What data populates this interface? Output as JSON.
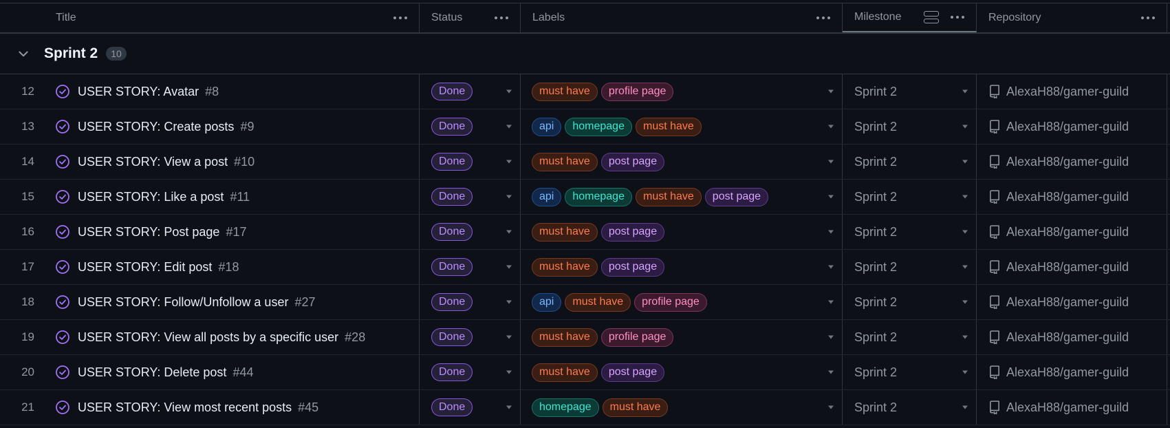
{
  "columns": {
    "title": "Title",
    "status": "Status",
    "labels": "Labels",
    "milestone": "Milestone",
    "repository": "Repository"
  },
  "group": {
    "title": "Sprint 2",
    "count": "10"
  },
  "label_styles": {
    "must have": {
      "fg": "#ff7b4d",
      "bg": "#3a1d13",
      "border": "#7a3a22"
    },
    "profile page": {
      "fg": "#ff8fc4",
      "bg": "#3c1a2d",
      "border": "#7d3461"
    },
    "api": {
      "fg": "#79b8ff",
      "bg": "#11284a",
      "border": "#1f4f8f"
    },
    "homepage": {
      "fg": "#3ce6d2",
      "bg": "#0c3b36",
      "border": "#13756b"
    },
    "post page": {
      "fg": "#d7a4ff",
      "bg": "#2c1c43",
      "border": "#5f3a8f"
    }
  },
  "rows": [
    {
      "num": "12",
      "title": "USER STORY: Avatar",
      "issue": "#8",
      "status": "Done",
      "labels": [
        "must have",
        "profile page"
      ],
      "milestone": "Sprint 2",
      "repo": "AlexaH88/gamer-guild"
    },
    {
      "num": "13",
      "title": "USER STORY: Create posts",
      "issue": "#9",
      "status": "Done",
      "labels": [
        "api",
        "homepage",
        "must have"
      ],
      "milestone": "Sprint 2",
      "repo": "AlexaH88/gamer-guild"
    },
    {
      "num": "14",
      "title": "USER STORY: View a post",
      "issue": "#10",
      "status": "Done",
      "labels": [
        "must have",
        "post page"
      ],
      "milestone": "Sprint 2",
      "repo": "AlexaH88/gamer-guild"
    },
    {
      "num": "15",
      "title": "USER STORY: Like a post",
      "issue": "#11",
      "status": "Done",
      "labels": [
        "api",
        "homepage",
        "must have",
        "post page"
      ],
      "milestone": "Sprint 2",
      "repo": "AlexaH88/gamer-guild"
    },
    {
      "num": "16",
      "title": "USER STORY: Post page",
      "issue": "#17",
      "status": "Done",
      "labels": [
        "must have",
        "post page"
      ],
      "milestone": "Sprint 2",
      "repo": "AlexaH88/gamer-guild"
    },
    {
      "num": "17",
      "title": "USER STORY: Edit post",
      "issue": "#18",
      "status": "Done",
      "labels": [
        "must have",
        "post page"
      ],
      "milestone": "Sprint 2",
      "repo": "AlexaH88/gamer-guild"
    },
    {
      "num": "18",
      "title": "USER STORY: Follow/Unfollow a user",
      "issue": "#27",
      "status": "Done",
      "labels": [
        "api",
        "must have",
        "profile page"
      ],
      "milestone": "Sprint 2",
      "repo": "AlexaH88/gamer-guild"
    },
    {
      "num": "19",
      "title": "USER STORY: View all posts by a specific user",
      "issue": "#28",
      "status": "Done",
      "labels": [
        "must have",
        "profile page"
      ],
      "milestone": "Sprint 2",
      "repo": "AlexaH88/gamer-guild"
    },
    {
      "num": "20",
      "title": "USER STORY: Delete post",
      "issue": "#44",
      "status": "Done",
      "labels": [
        "must have",
        "post page"
      ],
      "milestone": "Sprint 2",
      "repo": "AlexaH88/gamer-guild"
    },
    {
      "num": "21",
      "title": "USER STORY: View most recent posts",
      "issue": "#45",
      "status": "Done",
      "labels": [
        "homepage",
        "must have"
      ],
      "milestone": "Sprint 2",
      "repo": "AlexaH88/gamer-guild"
    }
  ]
}
